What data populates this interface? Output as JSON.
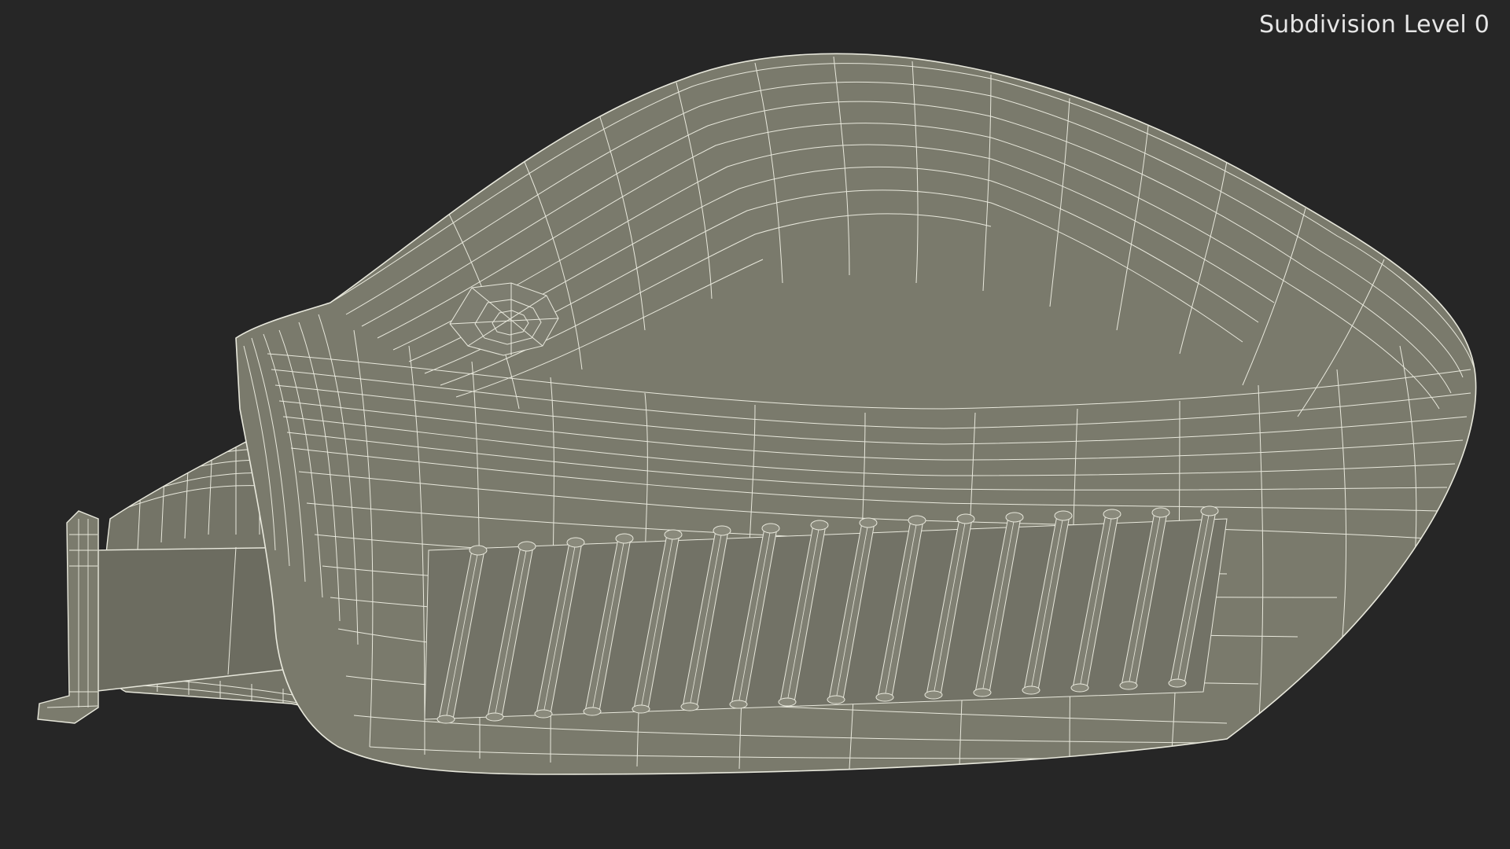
{
  "viewport": {
    "label": "Subdivision Level 0"
  },
  "model": {
    "description_icon": "wireframe-mirror-housing",
    "surface_color": "#7a7a6c",
    "surface_dark_color": "#6a6a5e",
    "wire_color": "#e8e8dc",
    "background_color": "#262626"
  }
}
